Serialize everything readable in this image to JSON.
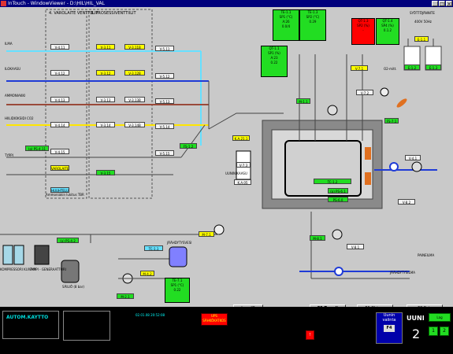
{
  "window": {
    "title": "InTouch - WindowViewer - D:\\HIL\\HIL_VAL"
  },
  "sections": {
    "varolaiteventtiilit": "4. VAROLAITE VENTTIILIT",
    "prosessiventtiilit": "3. PROSESSIVENTTIILIT",
    "syottojannite": "SYÖTTÖJÄNNITE",
    "voltage": "400V 50Hz",
    "ammoniakin_lukitus": "Ammoniakin lukitus TBR"
  },
  "lines": {
    "ilma": "ILMA",
    "ilokaasu": "ILOKAASU",
    "ammoniakki": "AMMONIAKKI",
    "hiilidioksidi": "HIILIDIOKSIDI CO2",
    "typpi": "TYPPI"
  },
  "valves": {
    "v411": "V-4.11",
    "v412": "V-4.12",
    "v413": "V-4.13",
    "v414": "V-4.14",
    "v415": "V-4.15",
    "v311": "V-3.11",
    "v312": "V-3.12",
    "v313": "V-3.13",
    "v314": "V-3.14",
    "v315": "V-3.15",
    "v311b": "V-3.11B",
    "v312b": "V-3.12B",
    "v313b": "V-3.13B",
    "v314b": "V-3.14B",
    "v511": "V-5.11",
    "v512": "V-5.12",
    "v513": "V-5.13",
    "v514": "V-5.14",
    "v515": "V-5.15",
    "v71": "V-7.1",
    "v72": "V-7.2",
    "v73": "V-7.3",
    "v81": "V-8.1",
    "v82": "V-8.2",
    "v41": "V-4.1"
  },
  "tags": {
    "ps411": "(o) PS-4.11",
    "varolaite": "VAROLAITE",
    "lukitus": "LUKITUS",
    "huuhtelu": "HUUHTELU",
    "ps42": "(o) PS-4.2",
    "tc11": "TC-1.1",
    "m71": "M-7.1",
    "m81": "M-8.1",
    "m11": "M-1.1",
    "m21": "M-2.1",
    "e11": "E-1.1",
    "e12": "E-1.2",
    "e13": "E-1.3",
    "ka21": "K.A.21.1",
    "ka05": "K.A.05",
    "fs71": "FS-7.1",
    "ps71": "PS-7.1",
    "ps72": "PS-7.2",
    "te71": "TE-7.1",
    "ps61": "(o) PS-6.1",
    "tc12": "TC-1.2",
    "ps60": "PS-6.0",
    "fs12": "FS-1.2",
    "m42": "M-4.2"
  },
  "te11": {
    "name": "TE-1.1",
    "sp": "SP1 (°C)",
    "a": "A:26",
    "v": "0.0/4"
  },
  "te13": {
    "name": "TE-1.3",
    "sp": "SP2 (°C)",
    "v": "0.29"
  },
  "qt11": {
    "name": "QT-1.1",
    "sp": "SP1 (%)",
    "a": "A:23",
    "v": "0.22"
  },
  "qt13": {
    "name": "QT-1.3",
    "sp": "SP2 (%)",
    "v": "-"
  },
  "qt14": {
    "name": "QT-1.4",
    "sp": "SP4 (%)",
    "v": "0.1.2"
  },
  "te71box": {
    "name": "TE-7.1",
    "sp": "SP1 (°C)",
    "v": "0.22"
  },
  "labels": {
    "jaahdytysvesi": "JÄÄHDYTYSVESI",
    "kompressori": "KOMPRESSORI KUIVAIN",
    "typpigen": "TYPPI - GENERAATTORI",
    "sailio": "SÄILIÖ (8 bar)",
    "jaahdytysilma": "JÄÄHDYTYSILMA",
    "paineilma": "PAINEILMA",
    "o2mittaus": "O2-mitt.",
    "uunin_kaasu": "UUNIN KAASU"
  },
  "nav": {
    "lag": "Lag. IO",
    "f5": "F5 Trendi",
    "f6": "F6 Ohjaus",
    "f8": "F8 Peis"
  },
  "bottom": {
    "mode": "AUTOM.KAYTTO",
    "datetime": "02.01.08  20:52:08",
    "ups1": "UPS",
    "ups2": "SÄHKÖKATKOS",
    "alarm": "!",
    "uunin1": "Uunin",
    "uunin2": "valinta",
    "f4": "F4",
    "uuni": "UUNI",
    "uuni_num": "2",
    "lag": "Lag",
    "sel1": "1",
    "sel2": "2"
  }
}
